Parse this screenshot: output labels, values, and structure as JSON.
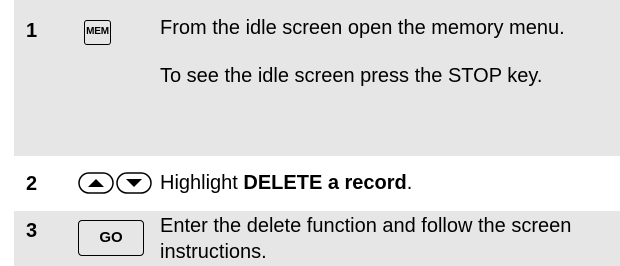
{
  "steps": [
    {
      "number": "1",
      "key_label": "MEM",
      "text1": "From the idle screen open the memory menu.",
      "text2": "To see the idle screen press the STOP key."
    },
    {
      "number": "2",
      "keys": [
        "up-arrow-icon",
        "down-arrow-icon"
      ],
      "text_prefix": "Highlight ",
      "text_bold": "DELETE a record",
      "text_suffix": "."
    },
    {
      "number": "3",
      "key_label": "GO",
      "text1": "Enter the delete function and follow the screen instructions."
    }
  ],
  "colors": {
    "shaded_row": "#e6e6e6",
    "text": "#000000"
  }
}
